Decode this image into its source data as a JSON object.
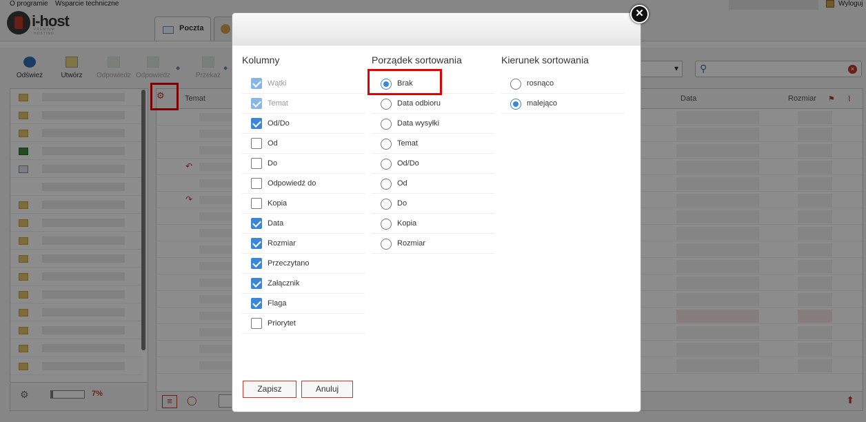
{
  "topbar": {
    "about": "O programie",
    "support": "Wsparcie techniczne",
    "logout": "Wyloguj"
  },
  "brand": {
    "name": "i-host",
    "tagline": "PREMIUM HOSTING"
  },
  "tabs": {
    "mail": "Poczta"
  },
  "toolbar": {
    "refresh": "Odśwież",
    "create": "Utwórz",
    "reply": "Odpowiedz",
    "reply_all": "Odpowiedz",
    "forward": "Przekaż"
  },
  "list": {
    "headers": {
      "subject": "Temat",
      "date": "Data",
      "size": "Rozmiar"
    }
  },
  "quota": {
    "percent_label": "7%",
    "used_fraction": 0.07
  },
  "dialog": {
    "columns": {
      "title": "Kolumny",
      "items": [
        {
          "label": "Wątki",
          "checked": true,
          "disabled": true
        },
        {
          "label": "Temat",
          "checked": true,
          "disabled": true
        },
        {
          "label": "Od/Do",
          "checked": true,
          "disabled": false
        },
        {
          "label": "Od",
          "checked": false,
          "disabled": false
        },
        {
          "label": "Do",
          "checked": false,
          "disabled": false
        },
        {
          "label": "Odpowiedź do",
          "checked": false,
          "disabled": false
        },
        {
          "label": "Kopia",
          "checked": false,
          "disabled": false
        },
        {
          "label": "Data",
          "checked": true,
          "disabled": false
        },
        {
          "label": "Rozmiar",
          "checked": true,
          "disabled": false
        },
        {
          "label": "Przeczytano",
          "checked": true,
          "disabled": false
        },
        {
          "label": "Załącznik",
          "checked": true,
          "disabled": false
        },
        {
          "label": "Flaga",
          "checked": true,
          "disabled": false
        },
        {
          "label": "Priorytet",
          "checked": false,
          "disabled": false
        }
      ]
    },
    "sort_order": {
      "title": "Porządek sortowania",
      "items": [
        {
          "label": "Brak",
          "selected": true
        },
        {
          "label": "Data odbioru",
          "selected": false
        },
        {
          "label": "Data wysyłki",
          "selected": false
        },
        {
          "label": "Temat",
          "selected": false
        },
        {
          "label": "Od/Do",
          "selected": false
        },
        {
          "label": "Od",
          "selected": false
        },
        {
          "label": "Do",
          "selected": false
        },
        {
          "label": "Kopia",
          "selected": false
        },
        {
          "label": "Rozmiar",
          "selected": false
        }
      ]
    },
    "sort_direction": {
      "title": "Kierunek sortowania",
      "items": [
        {
          "label": "rosnąco",
          "selected": false
        },
        {
          "label": "malejąco",
          "selected": true
        }
      ]
    },
    "save_label": "Zapisz",
    "cancel_label": "Anuluj"
  },
  "colors": {
    "accent": "#3b86d6",
    "highlight": "#e30000",
    "danger": "#c0392b"
  }
}
